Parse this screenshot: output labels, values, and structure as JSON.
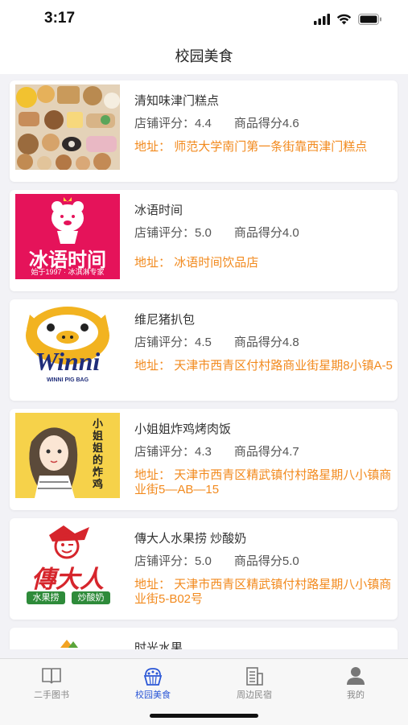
{
  "status": {
    "time": "3:17"
  },
  "nav": {
    "title": "校园美食"
  },
  "labels": {
    "shop_rating": "店铺评分：",
    "product_score": "商品得分",
    "address_prefix": "地址："
  },
  "shops": [
    {
      "name": "清知味津门糕点",
      "shop_rating": "4.4",
      "product_score": "4.6",
      "address": "师范大学南门第一条街靠西津门糕点"
    },
    {
      "name": "冰语时间",
      "shop_rating": "5.0",
      "product_score": "4.0",
      "address": "冰语时间饮品店",
      "logo_text": "冰语时间",
      "logo_sub": "始于1997 · 冰淇淋专家"
    },
    {
      "name": "维尼猪扒包",
      "shop_rating": "4.5",
      "product_score": "4.8",
      "address": "天津市西青区付村路商业街星期8小镇A-5",
      "logo_text": "Winni",
      "logo_sub": "WINNI PIG BAG"
    },
    {
      "name": "小姐姐炸鸡烤肉饭",
      "shop_rating": "4.3",
      "product_score": "4.7",
      "address": "天津市西青区精武镇付村路星期八小镇商业街5—AB—15",
      "logo_text": "小姐姐的炸鸡"
    },
    {
      "name": "傳大人水果捞 炒酸奶",
      "shop_rating": "5.0",
      "product_score": "5.0",
      "address": "天津市西青区精武镇付村路星期八小镇商业街5-B02号",
      "logo_text": "傳大人",
      "logo_tag1": "水果捞",
      "logo_tag2": "炒酸奶"
    },
    {
      "name": "时光水果"
    }
  ],
  "tabs": [
    {
      "label": "二手图书",
      "icon": "book-icon",
      "active": false
    },
    {
      "label": "校园美食",
      "icon": "cake-icon",
      "active": true
    },
    {
      "label": "周边民宿",
      "icon": "building-icon",
      "active": false
    },
    {
      "label": "我的",
      "icon": "person-icon",
      "active": false
    }
  ],
  "colors": {
    "accent": "#2a56d6",
    "address": "#f28a1e",
    "background": "#f2f2f6"
  }
}
